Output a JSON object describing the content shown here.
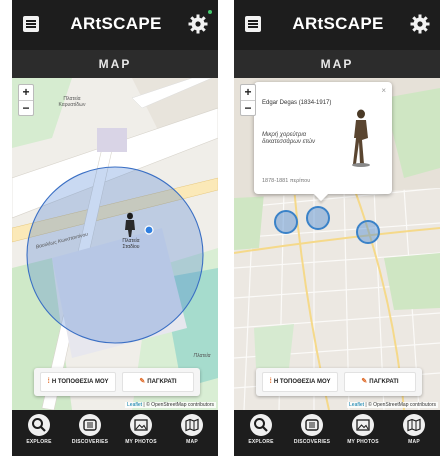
{
  "app": {
    "title": "ARtSCAPE",
    "section": "MAP"
  },
  "screen_left": {
    "map": {
      "zoom_in": "+",
      "zoom_out": "−",
      "location_label_line1": "Πλατεία",
      "location_label_line2": "Σταδίου",
      "street_label": "Βασιλέως Κωνσταντίνου",
      "park_label": "Πλατεία Καρυατίδων",
      "side_label": "Πλατεία"
    },
    "buttons": {
      "my_location": "Η ΤΟΠΟΘΕΣΙΑ ΜΟΥ",
      "district": "ΠΑΓΚΡΑΤΙ"
    },
    "attribution": {
      "leaflet": "Leaflet",
      "osm": "| © OpenStreetMap contributors"
    }
  },
  "screen_right": {
    "map": {
      "zoom_in": "+",
      "zoom_out": "−"
    },
    "popup": {
      "artist": "Edgar Degas (1834-1917)",
      "work": "Μικρή χορεύτρια δεκατεσσάρων ετών",
      "date": "1878-1881 περίπου",
      "close": "×"
    },
    "buttons": {
      "my_location": "Η ΤΟΠΟΘΕΣΙΑ ΜΟΥ",
      "district": "ΠΑΓΚΡΑΤΙ"
    },
    "attribution": {
      "leaflet": "Leaflet",
      "osm": "| © OpenStreetMap contributors"
    }
  },
  "nav": {
    "items": [
      {
        "label": "EXPLORE",
        "icon": "search-icon"
      },
      {
        "label": "DISCOVERIES",
        "icon": "book-icon"
      },
      {
        "label": "MY PHOTOS",
        "icon": "photo-icon"
      },
      {
        "label": "MAP",
        "icon": "map-icon"
      }
    ]
  },
  "colors": {
    "header": "#1d1d1d",
    "subbar": "#2c2c2c",
    "accent_blue": "#3a82c8",
    "marker_orange": "#e07030",
    "status_green": "#46c86e"
  }
}
